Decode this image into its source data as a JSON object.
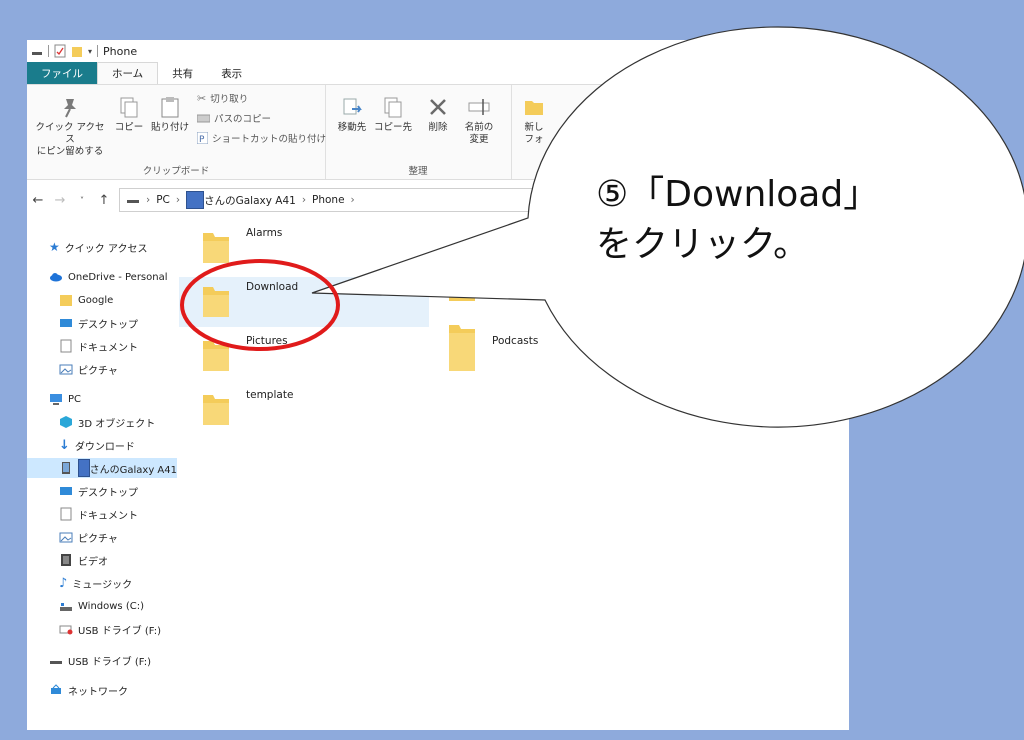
{
  "window": {
    "title": "Phone"
  },
  "ribbon_tabs": [
    "ファイル",
    "ホーム",
    "共有",
    "表示"
  ],
  "ribbon": {
    "clipboard": {
      "pin_label_1": "クイック アクセス",
      "pin_label_2": "にピン留めする",
      "copy_label": "コピー",
      "paste_label": "貼り付け",
      "cut_label": "切り取り",
      "copy_path_label": "パスのコピー",
      "paste_shortcut_label": "ショートカットの貼り付け",
      "group_label": "クリップボード"
    },
    "organize": {
      "move_label": "移動先",
      "copyto_label": "コピー先",
      "delete_label": "削除",
      "rename_label_1": "名前の",
      "rename_label_2": "変更",
      "group_label": "整理"
    },
    "new": {
      "new_label_1": "新し",
      "new_label_2": "フォ"
    }
  },
  "address": {
    "crumbs": [
      "PC",
      "さんのGalaxy A41",
      "Phone"
    ]
  },
  "nav_pane": {
    "quick_access": "クイック アクセス",
    "onedrive": "OneDrive - Personal",
    "google": "Google",
    "desktop": "デスクトップ",
    "documents": "ドキュメント",
    "pictures": "ピクチャ",
    "pc": "PC",
    "objects3d": "3D オブジェクト",
    "downloads": "ダウンロード",
    "galaxy": "さんのGalaxy A41",
    "desktop2": "デスクトップ",
    "documents2": "ドキュメント",
    "pictures2": "ピクチャ",
    "videos": "ビデオ",
    "music": "ミュージック",
    "windows_c": "Windows (C:)",
    "usb_f": "USB ドライブ (F:)",
    "usb_f2": "USB ドライブ (F:)",
    "network": "ネットワーク"
  },
  "folders": {
    "alarms": "Alarms",
    "download": "Download",
    "pictures": "Pictures",
    "podcasts": "Podcasts",
    "template": "template"
  },
  "callout": {
    "line1": "⑤「Download」",
    "line2": "をクリック。"
  },
  "colors": {
    "background": "#8eaadc",
    "file_tab": "#1a7c8c",
    "selected_tile": "#e5f1fb",
    "highlight_circle": "#e01b1b",
    "folder": "#f4cc5a"
  }
}
